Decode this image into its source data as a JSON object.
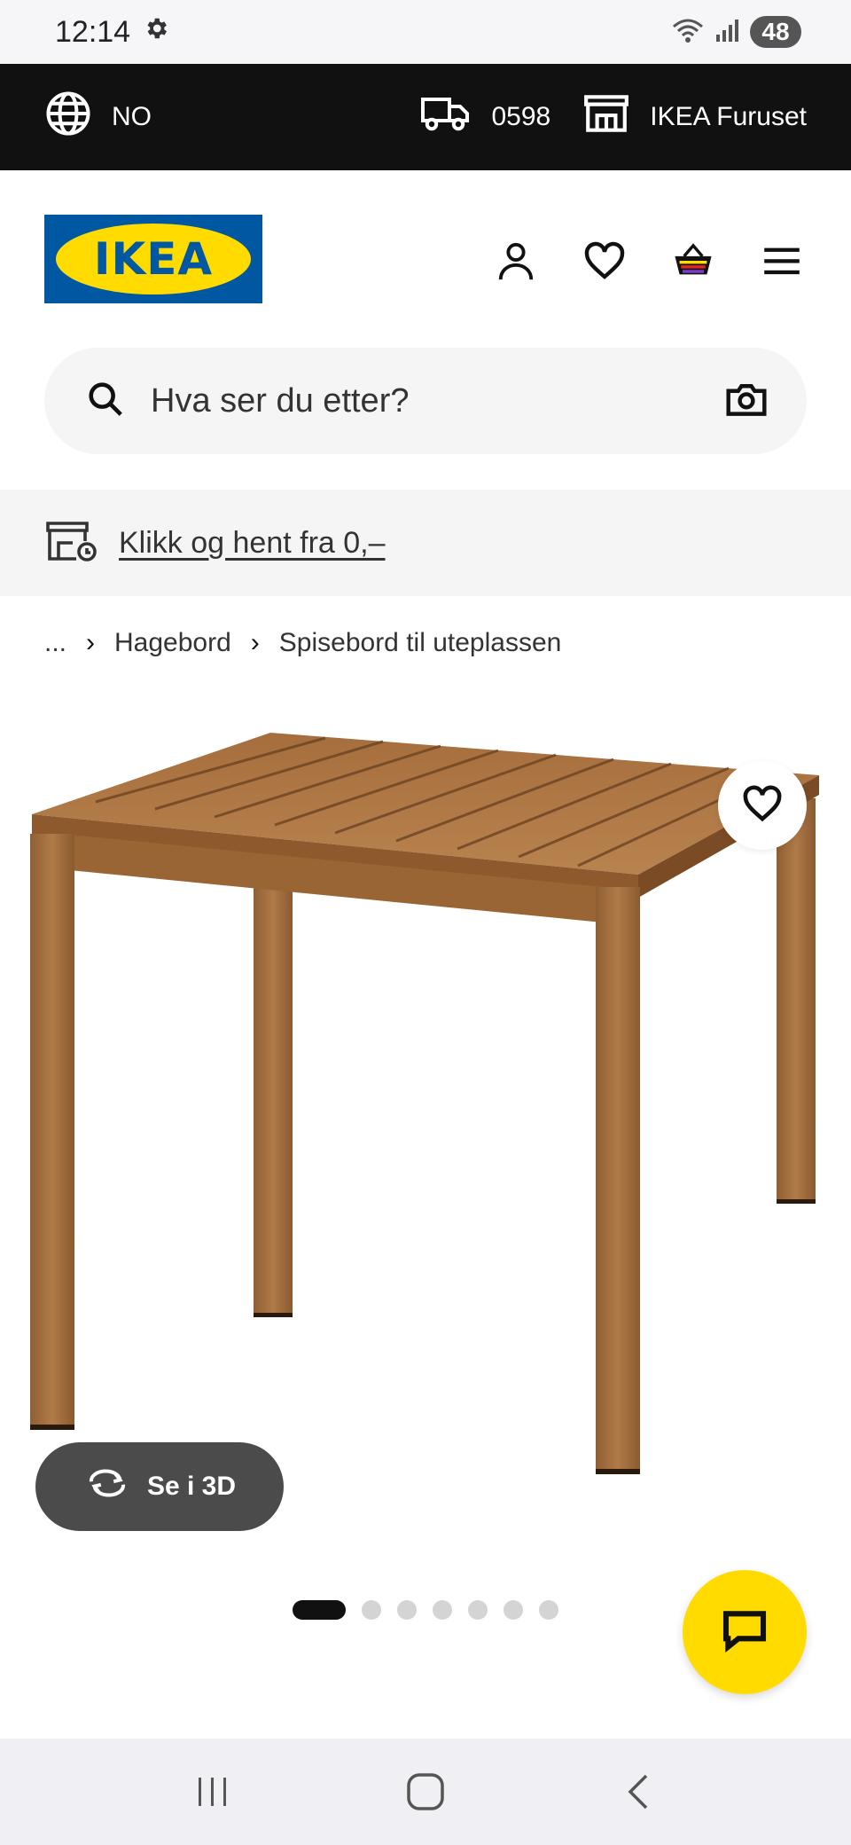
{
  "status_bar": {
    "time": "12:14",
    "battery": "48"
  },
  "top_bar": {
    "language": "NO",
    "postal_code": "0598",
    "store": "IKEA Furuset"
  },
  "header": {
    "logo_text": "IKEA"
  },
  "search": {
    "placeholder": "Hva ser du etter?"
  },
  "promo": {
    "text": "Klikk og hent fra 0,–"
  },
  "breadcrumb": {
    "ellipsis": "...",
    "items": [
      "Hagebord",
      "Spisebord til uteplassen"
    ]
  },
  "product": {
    "view_3d_label": "Se i 3D",
    "image_count": 7,
    "active_image": 1
  },
  "colors": {
    "brand_blue": "#0058a3",
    "brand_yellow": "#ffdb00",
    "dark": "#111111"
  }
}
